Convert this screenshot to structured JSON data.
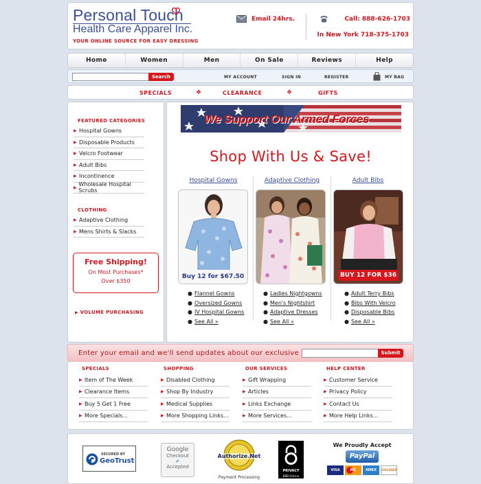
{
  "header": {
    "logo_line1": "Personal Touch",
    "logo_line2": "Health Care Apparel Inc.",
    "tagline": "YOUR ONLINE SOURCE FOR EASY DRESSING",
    "email_label": "Email 24hrs.",
    "call_label": "Call:",
    "call_number": "888-626-1703",
    "ny_label": "In New York",
    "ny_number": "718-375-1703"
  },
  "main_nav": [
    "Home",
    "Women",
    "Men",
    "On Sale",
    "Reviews",
    "Help"
  ],
  "search": {
    "placeholder": "",
    "button": "Search"
  },
  "account_links": {
    "my_account": "MY ACCOUNT",
    "sign_in": "SIGN IN",
    "register": "REGISTER",
    "my_bag": "MY BAG"
  },
  "sub_nav": [
    "SPECIALS",
    "CLEARANCE",
    "GIFTS"
  ],
  "sidebar": {
    "featured_heading": "FEATURED CATEGORIES",
    "featured_items": [
      "Hospital Gowns",
      "Disposable Products",
      "Velcro Footwear",
      "Adult Bibs",
      "Incontinence",
      "Wholesale Hospital Scrubs"
    ],
    "clothing_heading": "CLOTHING",
    "clothing_items": [
      "Adaptive Clothing",
      "Mens Shirts & Slacks"
    ],
    "free_shipping": {
      "title": "Free Shipping!",
      "line1": "On Most Purchases*",
      "line2": "Over $350"
    },
    "volume": "VOLUME PURCHASING"
  },
  "content": {
    "banner_text": "We Support Our Armed Forces",
    "headline": "Shop With Us & Save!",
    "columns": [
      {
        "title": "Hospital Gowns",
        "photo_caption": "Buy 12 for $67.50",
        "links": [
          "Flannel Gowns",
          "Oversized Gowns",
          "IV Hospital Gowns",
          "See All »"
        ]
      },
      {
        "title": "Adaptive Clothing",
        "photo_caption": "",
        "links": [
          "Ladies Nightgowns",
          "Men's Nightshirt",
          "Adaptive Dresses",
          "See All »"
        ]
      },
      {
        "title": "Adult Bibs",
        "photo_caption": "BUY 12 FOR $36",
        "links": [
          "Adult Terry Bibs",
          "Bibs With Velcro",
          "Disposable Bibs",
          "See All »"
        ]
      }
    ]
  },
  "newsletter": {
    "text": "Enter your email and we'll send updates about our exclusive offers",
    "placeholder": "",
    "button": "Submit"
  },
  "footer": {
    "columns": [
      {
        "heading": "SPECIALS",
        "items": [
          "Item of The Week",
          "Clearance Items",
          "Buy 5 Get 1 Free",
          "More Specials..."
        ]
      },
      {
        "heading": "SHOPPING",
        "items": [
          "Disabled Clothing",
          "Shop By Industry",
          "Medical Supplies",
          "More Shopping Links..."
        ]
      },
      {
        "heading": "OUR SERVICES",
        "items": [
          "Gift Wrapping",
          "Articles",
          "Links Exchange",
          "More Services..."
        ]
      },
      {
        "heading": "HELP CENTER",
        "items": [
          "Customer Service",
          "Privacy Policy",
          "Contact Us",
          "More Help Links..."
        ]
      }
    ]
  },
  "badges": {
    "geotrust_top": "SECURED BY",
    "geotrust_name": "GeoTrust",
    "google_line1": "Google",
    "google_line2": "Checkout",
    "google_line3": "Accepted",
    "authorize_name": "Authorize.Net",
    "authorize_caption": "Payment Processing",
    "privacy_label": "PRIVACY",
    "privacy_sub": "BBB OnLine",
    "accept_heading": "We Proudly Accept",
    "paypal": "PayPal",
    "cards": [
      "VISA",
      "MC",
      "AMEX",
      "DISCOVER"
    ]
  },
  "colors": {
    "brand_red": "#d6161c",
    "brand_blue": "#3a4d9a",
    "page_bg": "#dde3ec"
  }
}
